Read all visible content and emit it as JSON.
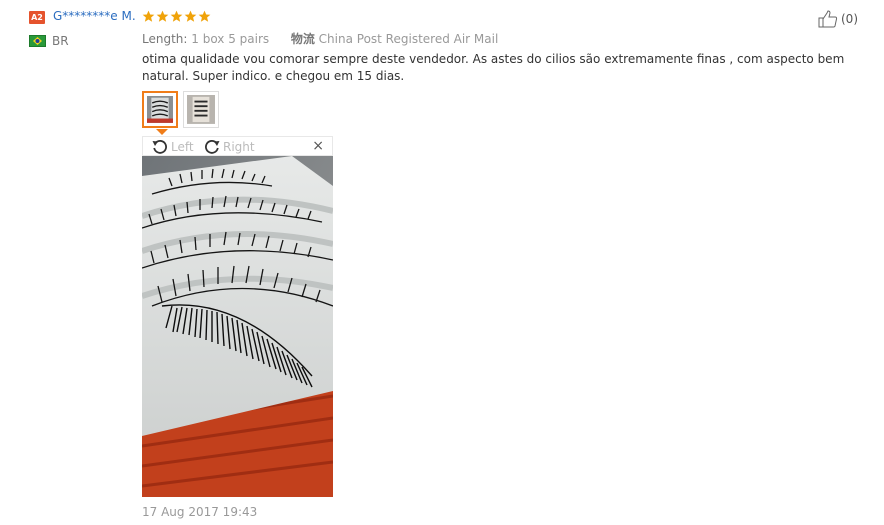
{
  "reviewer": {
    "level_badge": "A2",
    "name": "G********e M.",
    "country_code": "BR",
    "flag_color": "#29993a"
  },
  "rating": {
    "stars": 5,
    "max": 5,
    "color": "#f0a30a"
  },
  "purchase": {
    "length_label": "Length:",
    "length_value": "1 box 5 pairs",
    "shipping_label": "物流",
    "shipping_value": "China Post Registered Air Mail"
  },
  "review_text": "otima qualidade vou comorar sempre deste vendedor. As astes do cilios são extremamente finas , com aspecto bem natural. Super indico. e chegou em 15 dias.",
  "viewer": {
    "rotate_left_label": "Left",
    "rotate_right_label": "Right",
    "close_symbol": "×"
  },
  "date": "17 Aug 2017 19:43",
  "helpful": {
    "count_text": "(0)"
  },
  "accent_color": "#f07d19",
  "link_color": "#2b6dc0"
}
